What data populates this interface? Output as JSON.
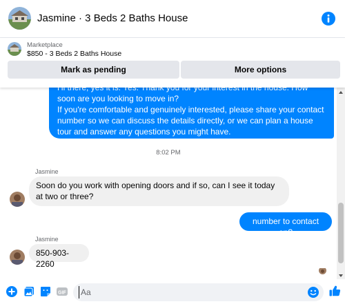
{
  "header": {
    "title": "Jasmine · 3 Beds 2 Baths House",
    "info_icon": "info-icon"
  },
  "marketplace": {
    "label": "Marketplace",
    "item": "$850 - 3 Beds 2 Baths House",
    "pending_button": "Mark as pending",
    "more_button": "More options"
  },
  "messages": [
    {
      "direction": "outgoing",
      "text": "Hi there, yes it is. Yes. Thank you for your interest in the house. How soon are you looking to move in?\nIf you're comfortable and genuinely interested, please share your contact number so we can discuss the details directly, or we can plan a house tour and answer any questions you might have."
    },
    {
      "direction": "incoming",
      "sender": "Jasmine",
      "text": "Soon do you work with opening doors and if so, can I see it today at two or three?"
    },
    {
      "direction": "outgoing",
      "text": "number to contact on?"
    },
    {
      "direction": "incoming",
      "sender": "Jasmine",
      "text": "850-903-2260"
    }
  ],
  "timestamp": "8:02 PM",
  "composer": {
    "placeholder": "Aa"
  },
  "colors": {
    "accent": "#0084ff",
    "incoming_bubble": "#f0f0f0",
    "button_bg": "#e4e6eb"
  }
}
